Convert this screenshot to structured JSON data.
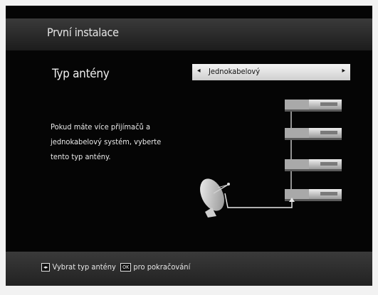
{
  "header": {
    "title": "První instalace"
  },
  "setting": {
    "label": "Typ antény",
    "value": "Jednokabelový",
    "left_arrow": "◂",
    "right_arrow": "▸"
  },
  "description": "Pokud máte více přijímačů a jednokabelový systém, vyberte tento typ antény.",
  "footer": {
    "nav_key": "◂▸",
    "nav_text": "Vybrat typ antény",
    "ok_key": "OK",
    "ok_text": "pro pokračování"
  },
  "diagram": {
    "receivers": 4,
    "icons": [
      "satellite-dish-icon",
      "receiver-box-icon"
    ]
  }
}
